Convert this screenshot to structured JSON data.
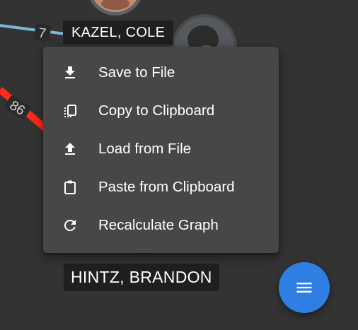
{
  "graph": {
    "nodes": [
      {
        "id": "kazel",
        "label": "KAZEL, COLE"
      },
      {
        "id": "hintz",
        "label": "HINTZ, BRANDON"
      }
    ],
    "edges": [
      {
        "id": "edge-blue",
        "weight_label": "7",
        "color": "#7fb6d6"
      },
      {
        "id": "edge-red",
        "weight_label": "86",
        "color": "#ff2a1a"
      }
    ]
  },
  "context_menu": {
    "items": [
      {
        "label": "Save to File",
        "icon": "download-icon"
      },
      {
        "label": "Copy to Clipboard",
        "icon": "copy-icon"
      },
      {
        "label": "Load from File",
        "icon": "upload-icon"
      },
      {
        "label": "Paste from Clipboard",
        "icon": "clipboard-icon"
      },
      {
        "label": "Recalculate Graph",
        "icon": "refresh-icon"
      }
    ]
  },
  "fab": {
    "icon": "menu-icon",
    "color": "#2f7fe3"
  },
  "colors": {
    "background": "#333333",
    "menu_background": "#474747",
    "label_background": "#1f1f1f"
  }
}
